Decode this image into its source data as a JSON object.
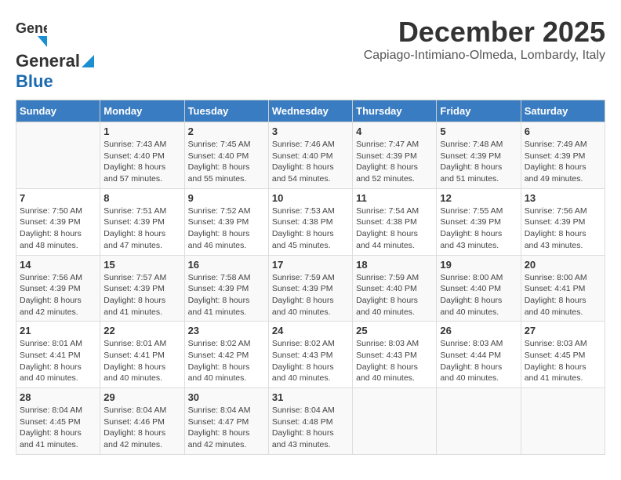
{
  "header": {
    "logo_line1": "General",
    "logo_line2": "Blue",
    "title": "December 2025",
    "subtitle": "Capiago-Intimiano-Olmeda, Lombardy, Italy"
  },
  "calendar": {
    "days_of_week": [
      "Sunday",
      "Monday",
      "Tuesday",
      "Wednesday",
      "Thursday",
      "Friday",
      "Saturday"
    ],
    "weeks": [
      [
        {
          "day": "",
          "info": ""
        },
        {
          "day": "1",
          "info": "Sunrise: 7:43 AM\nSunset: 4:40 PM\nDaylight: 8 hours\nand 57 minutes."
        },
        {
          "day": "2",
          "info": "Sunrise: 7:45 AM\nSunset: 4:40 PM\nDaylight: 8 hours\nand 55 minutes."
        },
        {
          "day": "3",
          "info": "Sunrise: 7:46 AM\nSunset: 4:40 PM\nDaylight: 8 hours\nand 54 minutes."
        },
        {
          "day": "4",
          "info": "Sunrise: 7:47 AM\nSunset: 4:39 PM\nDaylight: 8 hours\nand 52 minutes."
        },
        {
          "day": "5",
          "info": "Sunrise: 7:48 AM\nSunset: 4:39 PM\nDaylight: 8 hours\nand 51 minutes."
        },
        {
          "day": "6",
          "info": "Sunrise: 7:49 AM\nSunset: 4:39 PM\nDaylight: 8 hours\nand 49 minutes."
        }
      ],
      [
        {
          "day": "7",
          "info": "Sunrise: 7:50 AM\nSunset: 4:39 PM\nDaylight: 8 hours\nand 48 minutes."
        },
        {
          "day": "8",
          "info": "Sunrise: 7:51 AM\nSunset: 4:39 PM\nDaylight: 8 hours\nand 47 minutes."
        },
        {
          "day": "9",
          "info": "Sunrise: 7:52 AM\nSunset: 4:39 PM\nDaylight: 8 hours\nand 46 minutes."
        },
        {
          "day": "10",
          "info": "Sunrise: 7:53 AM\nSunset: 4:38 PM\nDaylight: 8 hours\nand 45 minutes."
        },
        {
          "day": "11",
          "info": "Sunrise: 7:54 AM\nSunset: 4:38 PM\nDaylight: 8 hours\nand 44 minutes."
        },
        {
          "day": "12",
          "info": "Sunrise: 7:55 AM\nSunset: 4:39 PM\nDaylight: 8 hours\nand 43 minutes."
        },
        {
          "day": "13",
          "info": "Sunrise: 7:56 AM\nSunset: 4:39 PM\nDaylight: 8 hours\nand 43 minutes."
        }
      ],
      [
        {
          "day": "14",
          "info": "Sunrise: 7:56 AM\nSunset: 4:39 PM\nDaylight: 8 hours\nand 42 minutes."
        },
        {
          "day": "15",
          "info": "Sunrise: 7:57 AM\nSunset: 4:39 PM\nDaylight: 8 hours\nand 41 minutes."
        },
        {
          "day": "16",
          "info": "Sunrise: 7:58 AM\nSunset: 4:39 PM\nDaylight: 8 hours\nand 41 minutes."
        },
        {
          "day": "17",
          "info": "Sunrise: 7:59 AM\nSunset: 4:39 PM\nDaylight: 8 hours\nand 40 minutes."
        },
        {
          "day": "18",
          "info": "Sunrise: 7:59 AM\nSunset: 4:40 PM\nDaylight: 8 hours\nand 40 minutes."
        },
        {
          "day": "19",
          "info": "Sunrise: 8:00 AM\nSunset: 4:40 PM\nDaylight: 8 hours\nand 40 minutes."
        },
        {
          "day": "20",
          "info": "Sunrise: 8:00 AM\nSunset: 4:41 PM\nDaylight: 8 hours\nand 40 minutes."
        }
      ],
      [
        {
          "day": "21",
          "info": "Sunrise: 8:01 AM\nSunset: 4:41 PM\nDaylight: 8 hours\nand 40 minutes."
        },
        {
          "day": "22",
          "info": "Sunrise: 8:01 AM\nSunset: 4:41 PM\nDaylight: 8 hours\nand 40 minutes."
        },
        {
          "day": "23",
          "info": "Sunrise: 8:02 AM\nSunset: 4:42 PM\nDaylight: 8 hours\nand 40 minutes."
        },
        {
          "day": "24",
          "info": "Sunrise: 8:02 AM\nSunset: 4:43 PM\nDaylight: 8 hours\nand 40 minutes."
        },
        {
          "day": "25",
          "info": "Sunrise: 8:03 AM\nSunset: 4:43 PM\nDaylight: 8 hours\nand 40 minutes."
        },
        {
          "day": "26",
          "info": "Sunrise: 8:03 AM\nSunset: 4:44 PM\nDaylight: 8 hours\nand 40 minutes."
        },
        {
          "day": "27",
          "info": "Sunrise: 8:03 AM\nSunset: 4:45 PM\nDaylight: 8 hours\nand 41 minutes."
        }
      ],
      [
        {
          "day": "28",
          "info": "Sunrise: 8:04 AM\nSunset: 4:45 PM\nDaylight: 8 hours\nand 41 minutes."
        },
        {
          "day": "29",
          "info": "Sunrise: 8:04 AM\nSunset: 4:46 PM\nDaylight: 8 hours\nand 42 minutes."
        },
        {
          "day": "30",
          "info": "Sunrise: 8:04 AM\nSunset: 4:47 PM\nDaylight: 8 hours\nand 42 minutes."
        },
        {
          "day": "31",
          "info": "Sunrise: 8:04 AM\nSunset: 4:48 PM\nDaylight: 8 hours\nand 43 minutes."
        },
        {
          "day": "",
          "info": ""
        },
        {
          "day": "",
          "info": ""
        },
        {
          "day": "",
          "info": ""
        }
      ]
    ]
  }
}
